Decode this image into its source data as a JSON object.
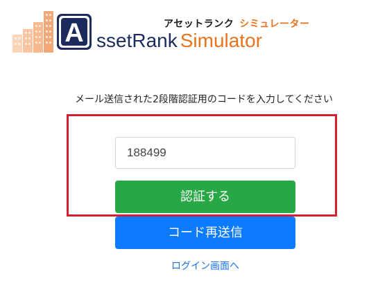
{
  "logo": {
    "letter": "A",
    "wordmark_part1": "ssetRank",
    "wordmark_part2": "Simulator",
    "kana_part1": "アセットランク",
    "kana_part2": "シミュレーター",
    "colors": {
      "navy": "#1b2b5e",
      "orange": "#e8731c",
      "peach": "#f7b98e"
    }
  },
  "instruction": "メール送信された2段階認証用のコードを入力してください",
  "code_input": {
    "value": "188499",
    "placeholder": ""
  },
  "verify_button": {
    "label": "認証する",
    "color": "#28a745"
  },
  "resend_button": {
    "label": "コード再送信",
    "color": "#0d7bff"
  },
  "login_link": {
    "label": "ログイン画面へ"
  },
  "highlight": {
    "color": "#d71f2b"
  }
}
